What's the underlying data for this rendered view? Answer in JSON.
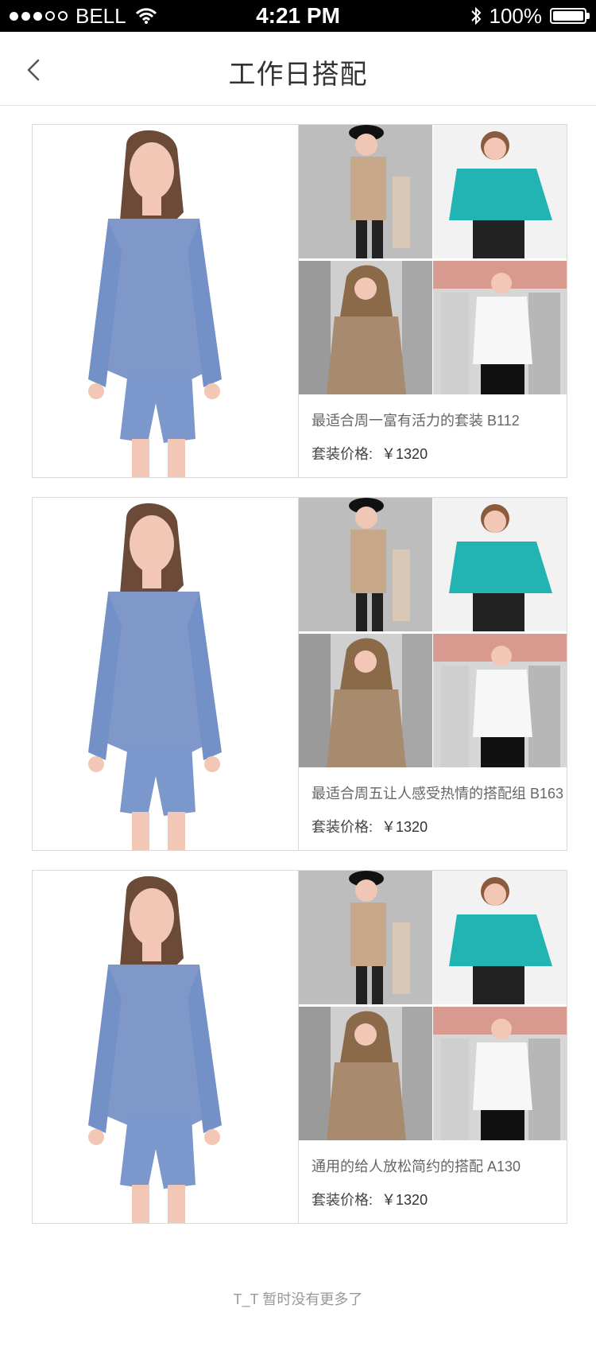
{
  "status_bar": {
    "carrier": "BELL",
    "time": "4:21 PM",
    "battery": "100%"
  },
  "nav": {
    "title": "工作日搭配"
  },
  "outfits": [
    {
      "description": "最适合周一富有活力的套装 B112",
      "price_label": "套装价格:",
      "price_value": "￥1320"
    },
    {
      "description": "最适合周五让人感受热情的搭配组 B163",
      "price_label": "套装价格:",
      "price_value": "￥1320"
    },
    {
      "description": "通用的给人放松简约的搭配 A130",
      "price_label": "套装价格:",
      "price_value": "￥1320"
    }
  ],
  "footer": {
    "message": "T_T 暂时没有更多了"
  }
}
